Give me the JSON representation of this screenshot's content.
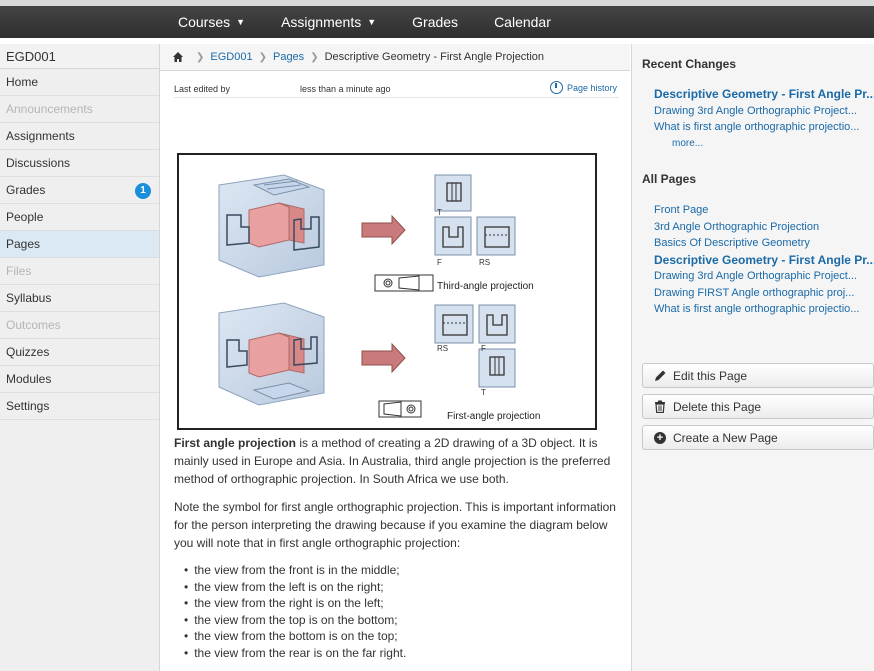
{
  "topnav": {
    "courses": "Courses",
    "assignments": "Assignments",
    "grades": "Grades",
    "calendar": "Calendar"
  },
  "sidebar": {
    "course_code": "EGD001",
    "items": [
      {
        "label": "Home",
        "state": "normal"
      },
      {
        "label": "Announcements",
        "state": "disabled"
      },
      {
        "label": "Assignments",
        "state": "normal"
      },
      {
        "label": "Discussions",
        "state": "normal"
      },
      {
        "label": "Grades",
        "state": "normal",
        "badge": "1"
      },
      {
        "label": "People",
        "state": "normal"
      },
      {
        "label": "Pages",
        "state": "active"
      },
      {
        "label": "Files",
        "state": "disabled"
      },
      {
        "label": "Syllabus",
        "state": "normal"
      },
      {
        "label": "Outcomes",
        "state": "disabled"
      },
      {
        "label": "Quizzes",
        "state": "normal"
      },
      {
        "label": "Modules",
        "state": "normal"
      },
      {
        "label": "Settings",
        "state": "normal"
      }
    ]
  },
  "breadcrumb": {
    "course": "EGD001",
    "section": "Pages",
    "page": "Descriptive Geometry - First Angle Projection"
  },
  "page_meta": {
    "last_edited_by": "Last edited by",
    "last_edited_time": "less than a minute ago",
    "history_link": "Page history"
  },
  "figure": {
    "label_top": "Third-angle projection",
    "label_bottom": "First-angle projection",
    "view_labels": {
      "T": "T",
      "F": "F",
      "RS": "RS"
    }
  },
  "content": {
    "p1_bold": "First angle projection",
    "p1_rest": " is a method of creating a 2D drawing of a 3D object. It is mainly used in Europe and Asia. In Australia, third angle projection is the preferred method of orthographic projection. In South Africa we use both.",
    "p2": "Note the symbol for first angle orthographic projection. This is important information for the person interpreting the drawing because if you examine the diagram below you will note that in first angle orthographic projection:",
    "bullets": [
      "the view from the front is in the middle;",
      "the view from the left is on the right;",
      "the view from the right is on the left;",
      "the view from the top  is on the bottom;",
      "the view from the bottom is on the top;",
      "the view from the rear is on the far right."
    ]
  },
  "right": {
    "recent_title": "Recent Changes",
    "recent": [
      "Descriptive Geometry - First Angle Pr...",
      "Drawing 3rd Angle Orthographic Project...",
      "What is first angle orthographic projectio..."
    ],
    "more": "more...",
    "all_title": "All Pages",
    "all": [
      "Front Page",
      "3rd Angle Orthographic Projection",
      "Basics Of Descriptive Geometry",
      "Descriptive Geometry - First Angle Pr...",
      "Drawing 3rd Angle Orthographic Project...",
      "Drawing FIRST Angle orthographic proj...",
      "What is first angle orthographic projectio..."
    ],
    "edit_button": "Edit this Page",
    "delete_button": "Delete this Page",
    "create_button": "Create a New Page"
  },
  "colors": {
    "link": "#1a6aa8",
    "active_nav": "#dbe9f4",
    "badge": "#1a8fdc",
    "topbar": "#3a3a3a"
  }
}
